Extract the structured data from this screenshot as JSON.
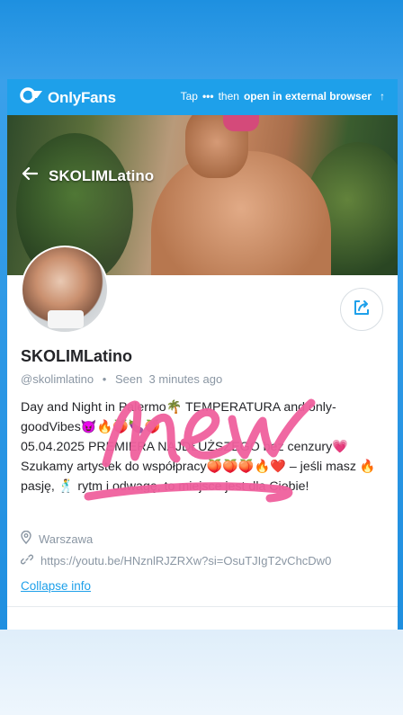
{
  "header": {
    "brand": "OnlyFans",
    "hint_tap": "Tap",
    "hint_dots": "•••",
    "hint_then": "then",
    "hint_action": "open in external browser",
    "hint_arrow": "↑"
  },
  "profile": {
    "title": "SKOLIMLatino",
    "name": "SKOLIMLatino",
    "handle": "@skolimlatino",
    "separator": "•",
    "seen": "Seen  3 minutes ago",
    "bio": "Day and Night in Palermo🌴 TEMPERATURA and only-goodVibes😈🔥🍑🍆🍑\n05.04.2025 PREMIERA NAJDŁUŻSZEGO bez cenzury💗\nSzukamy artystek do współpracy🍑🍑🍑🔥❤️ – jeśli masz 🔥 pasję, 🕺 rytm i odwagę, to miejsce jest dla Ciebie!",
    "location": "Warszawa",
    "link": "https://youtu.be/HNznlRJZRXw?si=OsuTJIgT2vChcDw0",
    "collapse_label": "Collapse info"
  },
  "overlay": {
    "scribble_text": "new",
    "scribble_color": "#f0609e"
  },
  "colors": {
    "accent": "#1ea0ea",
    "text": "#242529",
    "muted": "#8a96a3"
  },
  "icons": [
    "onlyfans-logo-icon",
    "back-arrow-icon",
    "share-icon",
    "location-pin-icon",
    "link-icon",
    "more-dots-icon",
    "arrow-up-icon"
  ]
}
